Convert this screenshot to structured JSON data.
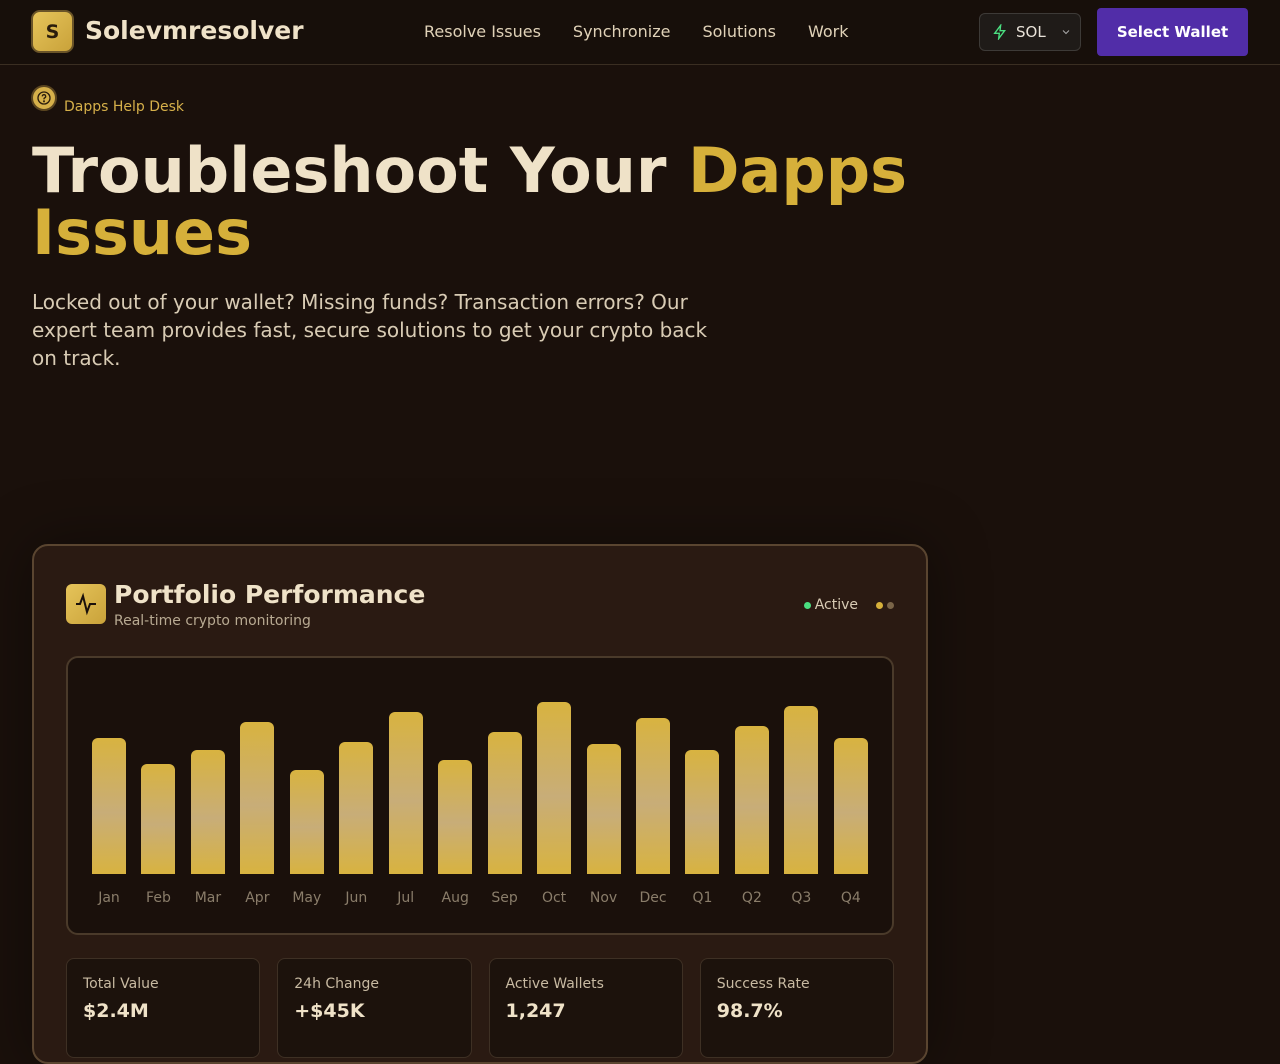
{
  "nav": {
    "logo_letter": "S",
    "brand": "Solevmresolver",
    "links": [
      "Resolve Issues",
      "Synchronize",
      "Solutions",
      "Work"
    ],
    "network": "SOL",
    "wallet_button": "Select Wallet"
  },
  "hero": {
    "badge": "Dapps Help Desk",
    "title_part1": "Troubleshoot Your ",
    "title_part2": "Dapps Issues",
    "lead": "Locked out of your wallet? Missing funds? Transaction errors? Our expert team provides fast, secure solutions to get your crypto back on track."
  },
  "card": {
    "title": "Portfolio Performance",
    "subtitle": "Real-time crypto monitoring",
    "status": "Active",
    "status_color": "#4ade80"
  },
  "chart_data": {
    "type": "bar",
    "categories": [
      "Jan",
      "Feb",
      "Mar",
      "Apr",
      "May",
      "Jun",
      "Jul",
      "Aug",
      "Sep",
      "Oct",
      "Nov",
      "Dec",
      "Q1",
      "Q2",
      "Q3",
      "Q4"
    ],
    "values": [
      68,
      55,
      62,
      76,
      52,
      66,
      81,
      57,
      71,
      86,
      65,
      78,
      62,
      74,
      84,
      68
    ],
    "ylim": [
      0,
      100
    ],
    "title": "",
    "xlabel": "",
    "ylabel": ""
  },
  "stats": [
    {
      "label": "Total Value",
      "value": "$2.4M"
    },
    {
      "label": "24h Change",
      "value": "+$45K"
    },
    {
      "label": "Active Wallets",
      "value": "1,247"
    },
    {
      "label": "Success Rate",
      "value": "98.7%"
    }
  ]
}
